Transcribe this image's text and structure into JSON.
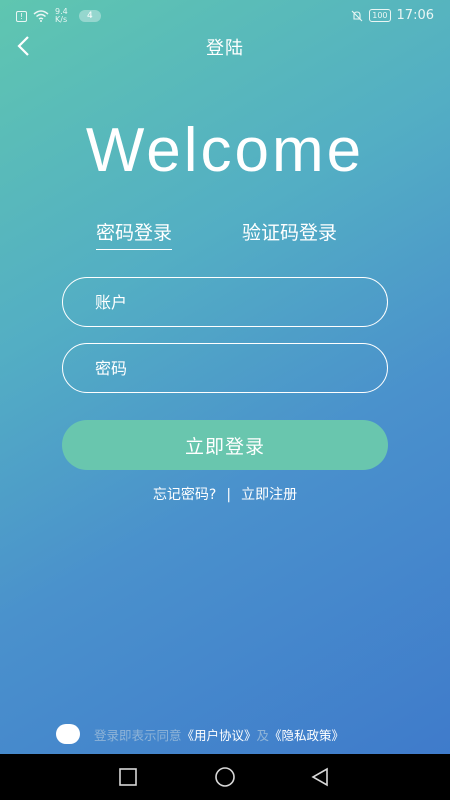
{
  "status_bar": {
    "net_speed": "9.4\nK/s",
    "badge": "4",
    "battery": "100",
    "time": "17:06"
  },
  "nav": {
    "title": "登陆"
  },
  "welcome": "Welcome",
  "tabs": [
    {
      "label": "密码登录",
      "active": true
    },
    {
      "label": "验证码登录",
      "active": false
    }
  ],
  "form": {
    "account_placeholder": "账户",
    "password_placeholder": "密码",
    "login_button": "立即登录"
  },
  "links": {
    "forgot": "忘记密码?",
    "separator": "|",
    "register": "立即注册"
  },
  "agreement": {
    "prefix": "登录即表示同意",
    "user_agreement": "《用户协议》",
    "conjunction": "及",
    "privacy_policy": "《隐私政策》"
  },
  "colors": {
    "gradient_top": "#5fc6b0",
    "gradient_bottom": "#3f7bcb",
    "button": "#69c6ae"
  }
}
